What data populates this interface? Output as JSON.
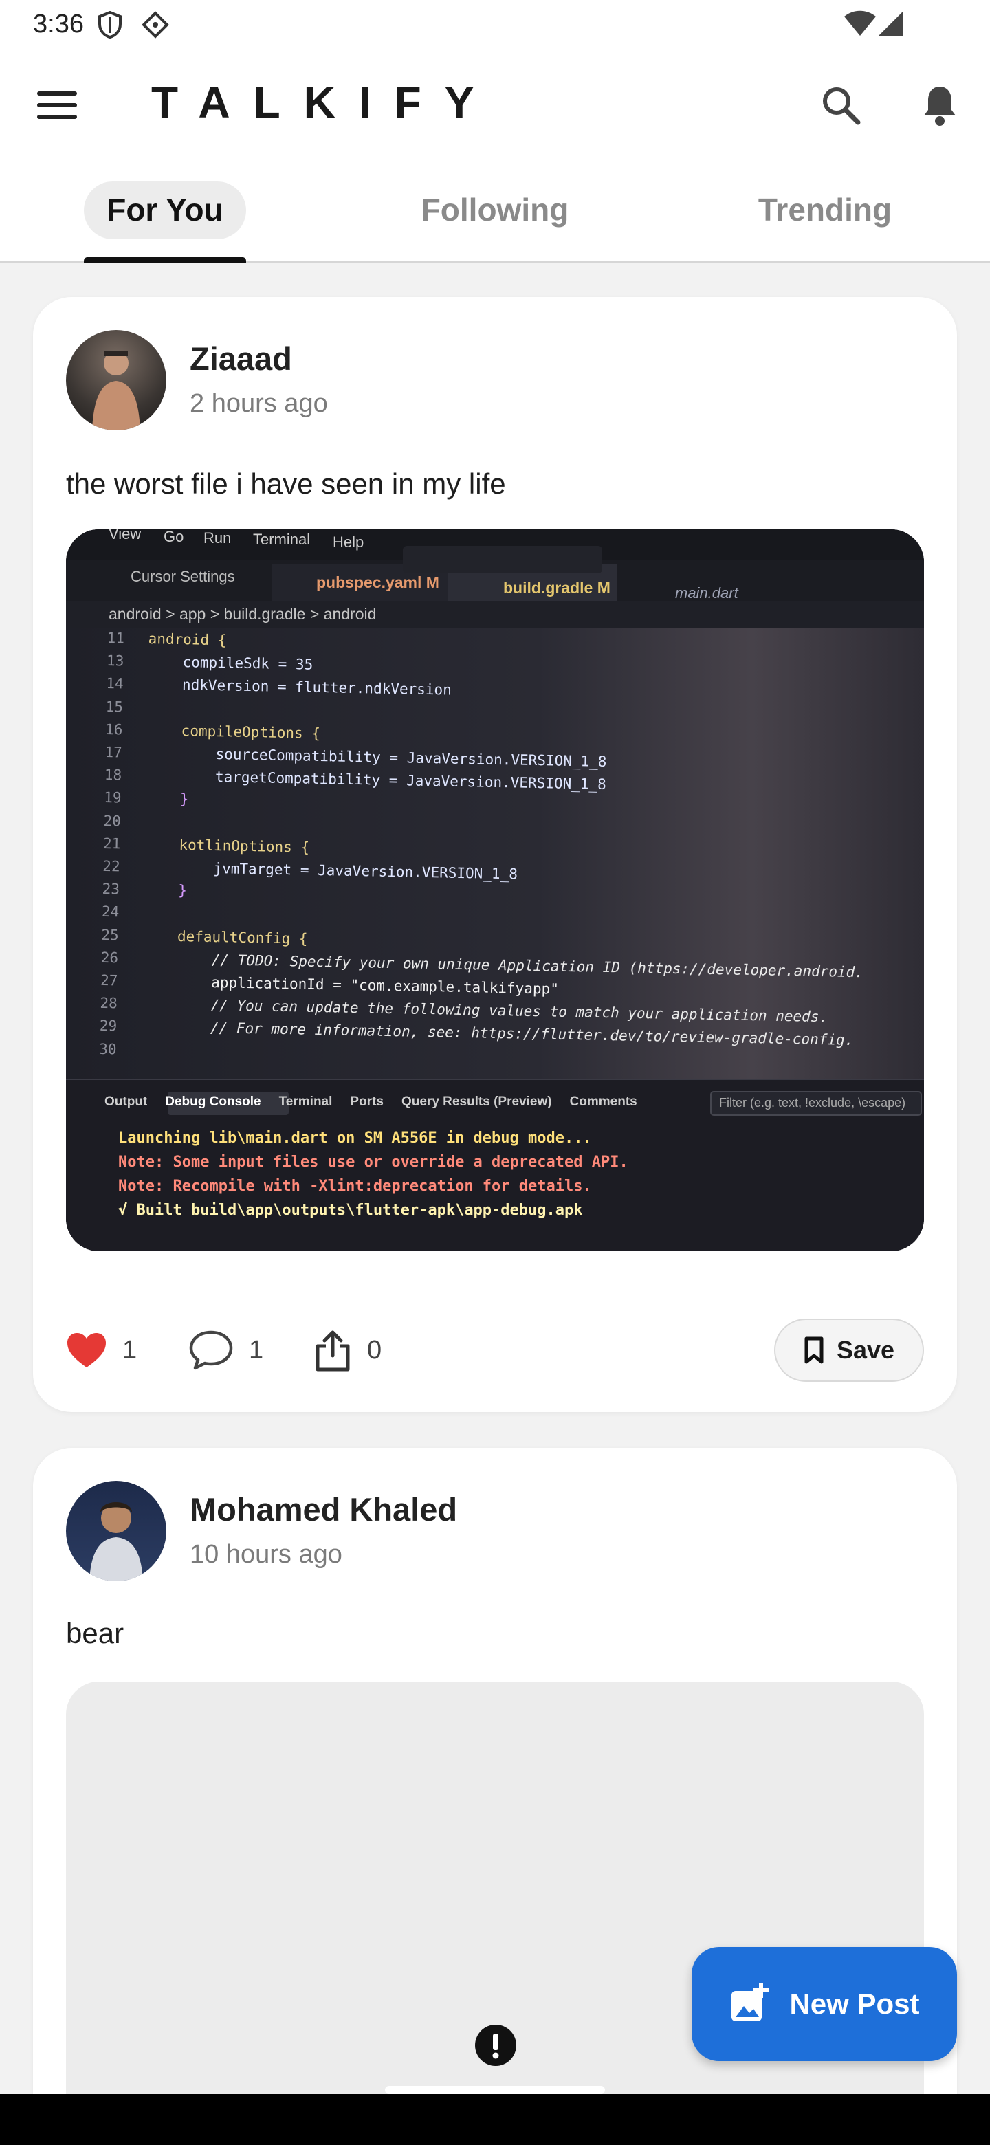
{
  "status_bar": {
    "time": "3:36"
  },
  "app_bar": {
    "title": "TALKIFY"
  },
  "tabs": [
    {
      "label": "For You",
      "active": true
    },
    {
      "label": "Following",
      "active": false
    },
    {
      "label": "Trending",
      "active": false
    }
  ],
  "posts": [
    {
      "author": "Ziaaad",
      "time": "2 hours ago",
      "text": "the worst file i have seen in my life",
      "likes": "1",
      "comments": "1",
      "shares": "0",
      "save_label": "Save",
      "image": {
        "menu": [
          "View",
          "Go",
          "Run",
          "Terminal",
          "Help"
        ],
        "tabs": [
          "Cursor Settings",
          "pubspec.yaml M",
          "build.gradle M",
          "main.dart"
        ],
        "breadcrumb": "android > app > build.gradle > android",
        "code": [
          {
            "n": "11",
            "t": "android {"
          },
          {
            "n": "13",
            "t": "    compileSdk = 35"
          },
          {
            "n": "14",
            "t": "    ndkVersion = flutter.ndkVersion"
          },
          {
            "n": "15",
            "t": ""
          },
          {
            "n": "16",
            "t": "    compileOptions {"
          },
          {
            "n": "17",
            "t": "        sourceCompatibility = JavaVersion.VERSION_1_8"
          },
          {
            "n": "18",
            "t": "        targetCompatibility = JavaVersion.VERSION_1_8"
          },
          {
            "n": "19",
            "t": "    }"
          },
          {
            "n": "20",
            "t": ""
          },
          {
            "n": "21",
            "t": "    kotlinOptions {"
          },
          {
            "n": "22",
            "t": "        jvmTarget = JavaVersion.VERSION_1_8"
          },
          {
            "n": "23",
            "t": "    }"
          },
          {
            "n": "24",
            "t": ""
          },
          {
            "n": "25",
            "t": "    defaultConfig {"
          },
          {
            "n": "26",
            "t": "        // TODO: Specify your own unique Application ID (https://developer.android."
          },
          {
            "n": "27",
            "t": "        applicationId = \"com.example.talkifyapp\""
          },
          {
            "n": "28",
            "t": "        // You can update the following values to match your application needs."
          },
          {
            "n": "29",
            "t": "        // For more information, see: https://flutter.dev/to/review-gradle-config."
          },
          {
            "n": "30",
            "t": ""
          }
        ],
        "panel_tabs": [
          "Output",
          "Debug Console",
          "Terminal",
          "Ports",
          "Query Results (Preview)",
          "Comments"
        ],
        "filter_placeholder": "Filter (e.g. text, !exclude, \\escape)",
        "console": [
          "Launching lib\\main.dart on SM A556E in debug mode...",
          "Note: Some input files use or override a deprecated API.",
          "Note: Recompile with -Xlint:deprecation for details.",
          "√ Built build\\app\\outputs\\flutter-apk\\app-debug.apk"
        ]
      }
    },
    {
      "author": "Mohamed Khaled",
      "time": "10 hours ago",
      "text": "bear"
    }
  ],
  "fab": {
    "label": "New Post"
  },
  "colors": {
    "accent": "#1e6fd9",
    "like": "#e53935",
    "background": "#f2f2f2"
  },
  "icons": [
    "menu-icon",
    "search-icon",
    "bell-icon",
    "heart-icon",
    "comment-icon",
    "share-icon",
    "bookmark-icon",
    "add-photo-icon",
    "error-icon"
  ]
}
